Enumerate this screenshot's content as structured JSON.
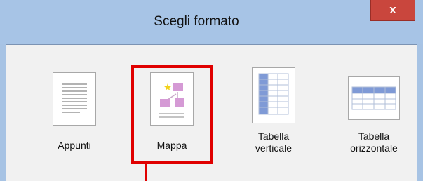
{
  "window": {
    "title": "Scegli formato",
    "close_label": "x"
  },
  "options": [
    {
      "label": "Appunti",
      "icon": "notes-document-icon"
    },
    {
      "label": "Mappa",
      "icon": "mind-map-icon"
    },
    {
      "label": "Tabella\nverticale",
      "icon": "vertical-table-icon"
    },
    {
      "label": "Tabella\norizzontale",
      "icon": "horizontal-table-icon"
    }
  ],
  "colors": {
    "titlebar": "#a7c4e6",
    "close_button": "#c9463d",
    "highlight": "#e00000",
    "map_node": "#d9a6d9",
    "table_header": "#8ea9db"
  }
}
